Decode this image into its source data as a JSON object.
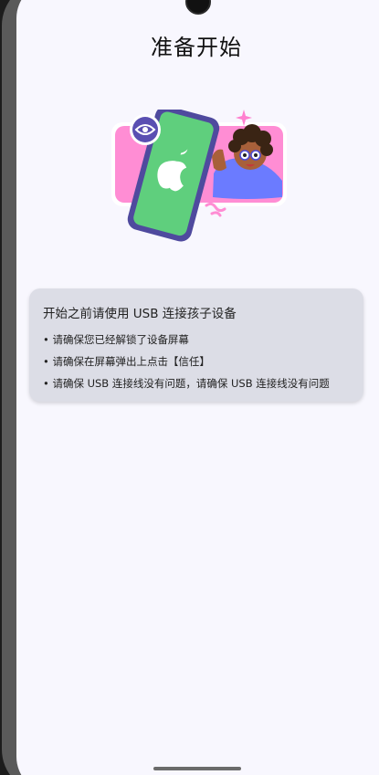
{
  "page": {
    "title": "准备开始"
  },
  "instructions": {
    "heading": "开始之前请使用 USB 连接孩子设备",
    "items": [
      "• 请确保您已经解锁了设备屏幕",
      "• 请确保在屏幕弹出上点击【信任】",
      "• 请确保 USB 连接线没有问题，请确保 USB 连接线没有问题"
    ]
  },
  "colors": {
    "background": "#f8f7fe",
    "card": "#dcdde6",
    "phone_green": "#5fcf7d",
    "accent_pink": "#ff8dd4",
    "accent_purple": "#5a4fb2"
  },
  "icons": {
    "eye_badge": "eye-icon",
    "apple_logo": "apple-logo-icon"
  }
}
